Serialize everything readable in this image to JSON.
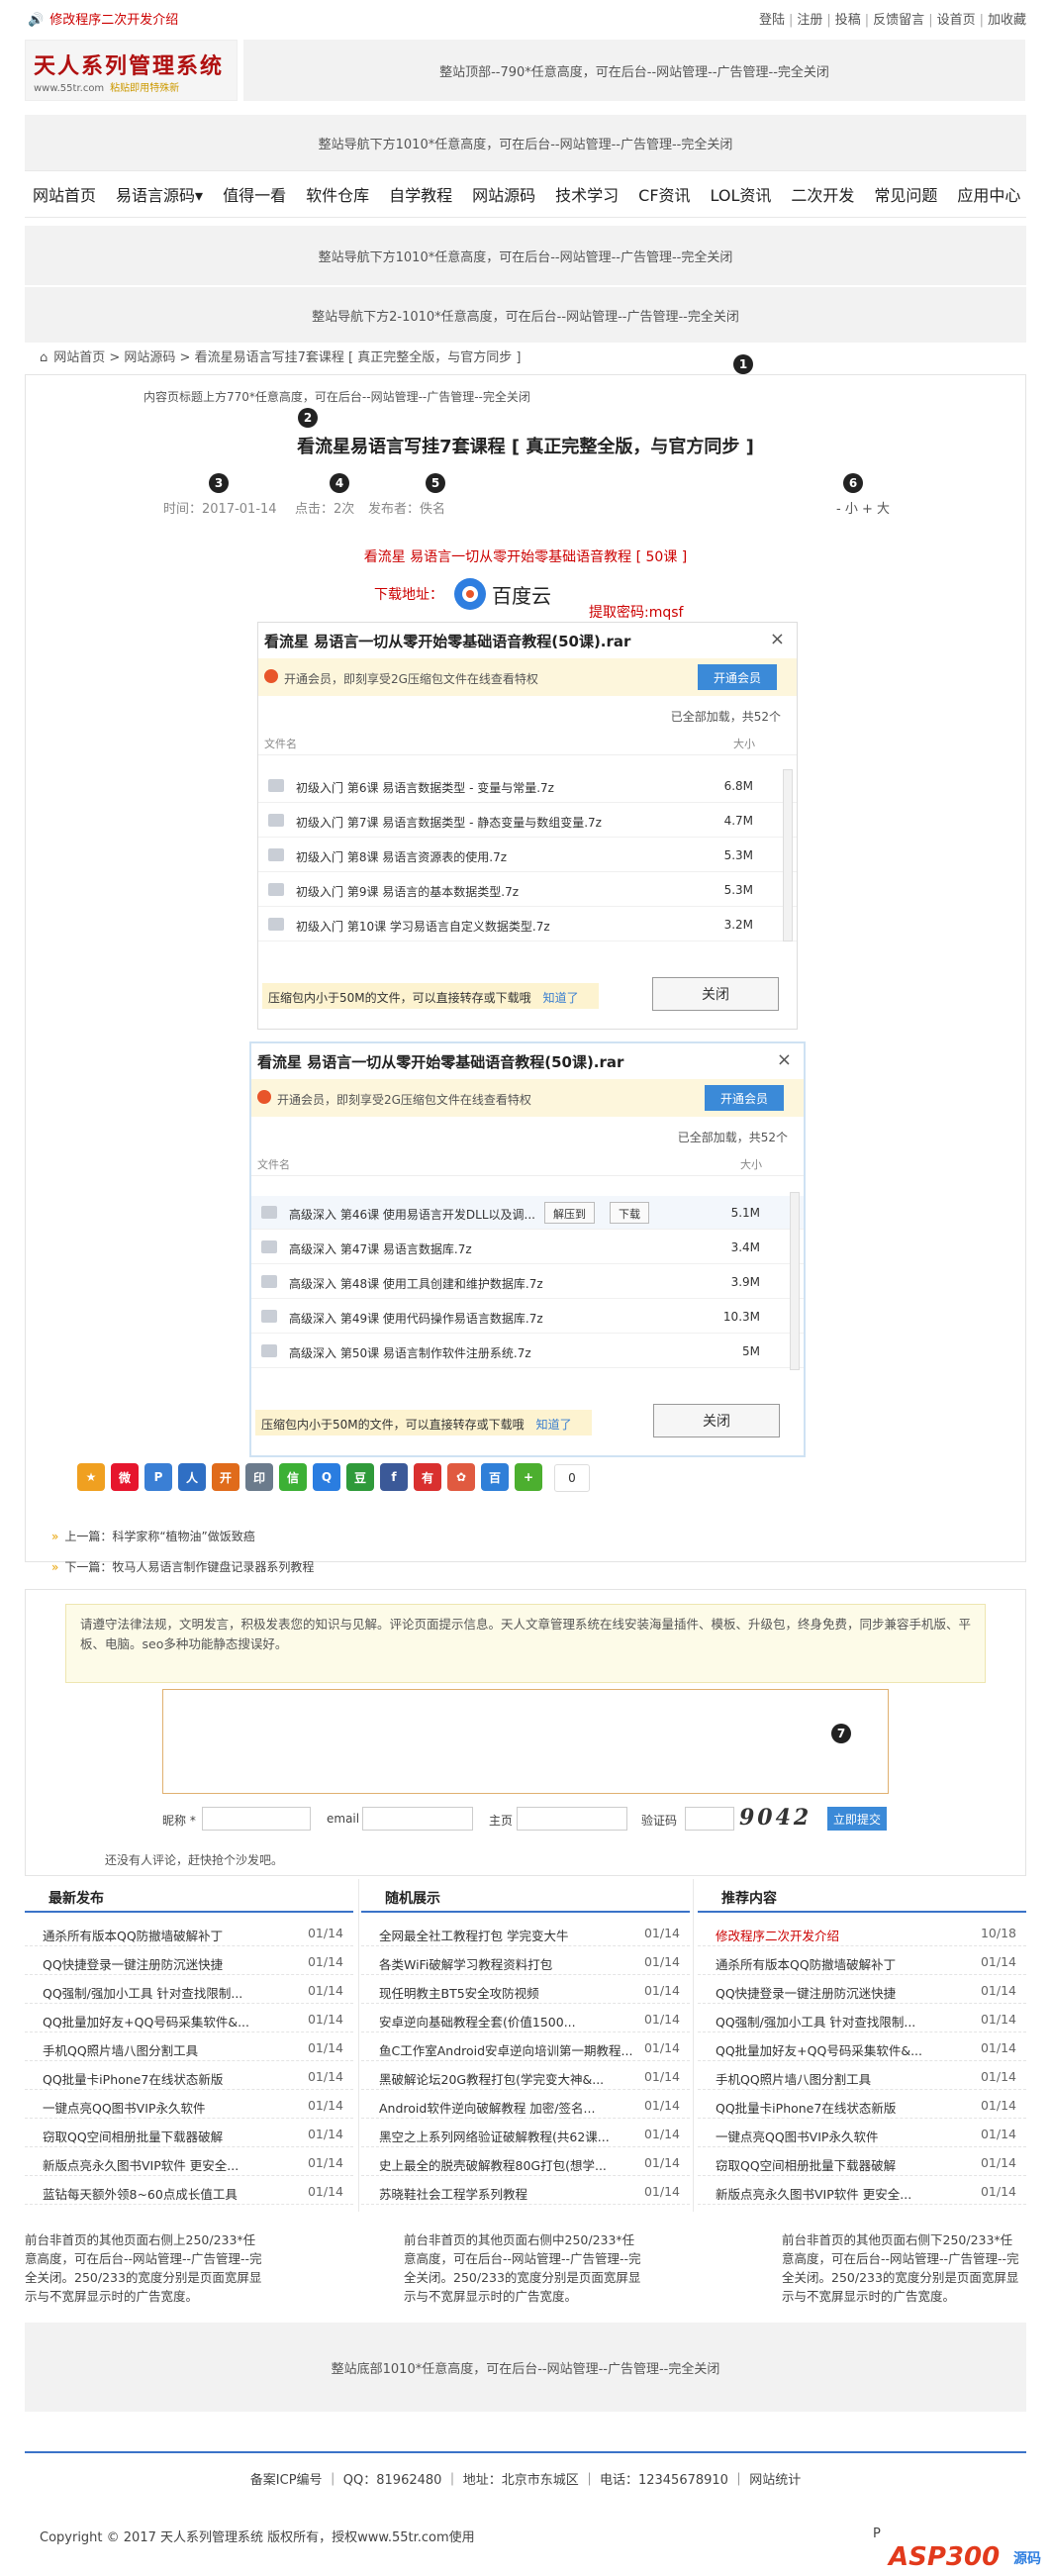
{
  "topbar": {
    "notice": "修改程序二次开发介绍",
    "links": [
      "登陆",
      "注册",
      "投稿",
      "反馈留言",
      "设首页",
      "加收藏"
    ]
  },
  "logo": {
    "title": "天人系列管理系统",
    "url": "www.55tr.com",
    "slogan": "粘贴即用特殊新"
  },
  "ads": {
    "header": "整站顶部--790*任意高度，可在后台--网站管理--广告管理--完全关闭",
    "nav_top": "整站导航下方1010*任意高度，可在后台--网站管理--广告管理--完全关闭",
    "nav_below1": "整站导航下方1010*任意高度，可在后台--网站管理--广告管理--完全关闭",
    "nav_below2": "整站导航下方2-1010*任意高度，可在后台--网站管理--广告管理--完全关闭",
    "content_top": "内容页标题上方770*任意高度，可在后台--网站管理--广告管理--完全关闭",
    "footer": "整站底部1010*任意高度，可在后台--网站管理--广告管理--完全关闭",
    "bottom": [
      "前台非首页的其他页面右侧上250/233*任意高度，可在后台--网站管理--广告管理--完全关闭。250/233的宽度分别是页面宽屏显示与不宽屏显示时的广告宽度。",
      "前台非首页的其他页面右侧中250/233*任意高度，可在后台--网站管理--广告管理--完全关闭。250/233的宽度分别是页面宽屏显示与不宽屏显示时的广告宽度。",
      "前台非首页的其他页面右侧下250/233*任意高度，可在后台--网站管理--广告管理--完全关闭。250/233的宽度分别是页面宽屏显示与不宽屏显示时的广告宽度。"
    ]
  },
  "nav": [
    "网站首页",
    "易语言源码▾",
    "值得一看",
    "软件仓库",
    "自学教程",
    "网站源码",
    "技术学习",
    "CF资讯",
    "LOL资讯",
    "二次开发",
    "常见问题",
    "应用中心"
  ],
  "breadcrumb": "网站首页 > 网站源码 > 看流星易语言写挂7套课程 [ 真正完整全版，与官方同步 ]",
  "article": {
    "title": "看流星易语言写挂7套课程 [ 真正完整全版，与官方同步 ]",
    "time": "时间：2017-01-14",
    "hits": "点击：2次",
    "author": "发布者：佚名",
    "fontsize": "- 小 + 大",
    "dl_title": "看流星 易语言一切从零开始零基础语音教程 [ 50课 ]",
    "dl_label": "下载地址：",
    "baidu": "百度云",
    "pwd": "提取密码:mqsf"
  },
  "badges": [
    "1",
    "2",
    "3",
    "4",
    "5",
    "6",
    "7"
  ],
  "pan1": {
    "title": "看流星 易语言一切从零开始零基础语音教程(50课).rar",
    "vip": "开通会员，即刻享受2G压缩包文件在线查看特权",
    "vip_btn": "开通会员",
    "count": "已全部加载，共52个",
    "col_name": "文件名",
    "col_size": "大小",
    "rows": [
      {
        "n": "初级入门 第6课 易语言数据类型 - 变量与常量.7z",
        "s": "6.8M"
      },
      {
        "n": "初级入门 第7课 易语言数据类型 - 静态变量与数组变量.7z",
        "s": "4.7M"
      },
      {
        "n": "初级入门 第8课 易语言资源表的使用.7z",
        "s": "5.3M"
      },
      {
        "n": "初级入门 第9课 易语言的基本数据类型.7z",
        "s": "5.3M"
      },
      {
        "n": "初级入门 第10课 学习易语言自定义数据类型.7z",
        "s": "3.2M"
      }
    ],
    "tip": "压缩包内小于50M的文件，可以直接转存或下载哦",
    "tip_link": "知道了",
    "close": "关闭"
  },
  "pan2": {
    "title": "看流星 易语言一切从零开始零基础语音教程(50课).rar",
    "vip": "开通会员，即刻享受2G压缩包文件在线查看特权",
    "vip_btn": "开通会员",
    "count": "已全部加载，共52个",
    "col_name": "文件名",
    "col_size": "大小",
    "rows": [
      {
        "n": "高级深入 第46课 使用易语言开发DLL以及调...",
        "s": "5.1M"
      },
      {
        "n": "高级深入 第47课 易语言数据库.7z",
        "s": "3.4M"
      },
      {
        "n": "高级深入 第48课 使用工具创建和维护数据库.7z",
        "s": "3.9M"
      },
      {
        "n": "高级深入 第49课 使用代码操作易语言数据库.7z",
        "s": "10.3M"
      },
      {
        "n": "高级深入 第50课 易语言制作软件注册系统.7z",
        "s": "5M"
      }
    ],
    "unzip": "解压到",
    "download": "下载",
    "tip": "压缩包内小于50M的文件，可以直接转存或下载哦",
    "tip_link": "知道了",
    "close": "关闭"
  },
  "share": {
    "icons": [
      {
        "name": "favorite-star-icon",
        "glyph": "★",
        "color": "#f0a020"
      },
      {
        "name": "weibo-icon",
        "glyph": "微",
        "color": "#e6162d"
      },
      {
        "name": "pinterest-icon",
        "glyph": "P",
        "color": "#3a7fd5"
      },
      {
        "name": "renren-icon",
        "glyph": "人",
        "color": "#2f6fc4"
      },
      {
        "name": "kaixin-icon",
        "glyph": "开",
        "color": "#e06b1b"
      },
      {
        "name": "print-icon",
        "glyph": "印",
        "color": "#6b7b8c"
      },
      {
        "name": "wechat-icon",
        "glyph": "信",
        "color": "#3cb035"
      },
      {
        "name": "qq-icon",
        "glyph": "Q",
        "color": "#2a7de0"
      },
      {
        "name": "douban-icon",
        "glyph": "豆",
        "color": "#2f9a3a"
      },
      {
        "name": "facebook-icon",
        "glyph": "f",
        "color": "#3b5998"
      },
      {
        "name": "youdao-icon",
        "glyph": "有",
        "color": "#d9302f"
      },
      {
        "name": "leaf-icon",
        "glyph": "✿",
        "color": "#e05a40"
      },
      {
        "name": "baidu-icon",
        "glyph": "百",
        "color": "#2f7fd8"
      },
      {
        "name": "more-plus-icon",
        "glyph": "+",
        "color": "#4caf2f"
      }
    ],
    "count": "0"
  },
  "prev": "上一篇：科学家称“植物油”做饭致癌",
  "next": "下一篇：牧马人易语言制作键盘记录器系列教程",
  "comment": {
    "notice": "请遵守法律法规，文明发言，积极发表您的知识与见解。评论页面提示信息。天人文章管理系统在线安装海量插件、模板、升级包，终身免费，同步兼容手机版、平板、电脑。seo多种功能静态搜误好。",
    "nick_label": "昵称 *",
    "email_label": "email",
    "home_label": "主页",
    "code_label": "验证码",
    "captcha": "9042",
    "submit": "立即提交",
    "none": "还没有人评论，赶快抢个沙发吧。"
  },
  "lists": [
    {
      "title": "最新发布",
      "items": [
        {
          "t": "通杀所有版本QQ防撤墙破解补丁",
          "d": "01/14"
        },
        {
          "t": "QQ快捷登录一键注册防沉迷快捷",
          "d": "01/14"
        },
        {
          "t": "QQ强制/强加小工具 针对查找限制...",
          "d": "01/14"
        },
        {
          "t": "QQ批量加好友+QQ号码采集软件&...",
          "d": "01/14"
        },
        {
          "t": "手机QQ照片墙八图分割工具",
          "d": "01/14"
        },
        {
          "t": "QQ批量卡iPhone7在线状态新版",
          "d": "01/14"
        },
        {
          "t": "一键点亮QQ图书VIP永久软件",
          "d": "01/14"
        },
        {
          "t": "窃取QQ空间相册批量下载器破解",
          "d": "01/14"
        },
        {
          "t": "新版点亮永久图书VIP软件 更安全...",
          "d": "01/14"
        },
        {
          "t": "蓝钻每天额外领8~60点成长值工具",
          "d": "01/14"
        }
      ]
    },
    {
      "title": "随机展示",
      "items": [
        {
          "t": "全网最全社工教程打包 学完变大牛",
          "d": "01/14"
        },
        {
          "t": "各类WiFi破解学习教程资料打包",
          "d": "01/14"
        },
        {
          "t": "现任明教主BT5安全攻防视频",
          "d": "01/14"
        },
        {
          "t": "安卓逆向基础教程全套(价值1500...",
          "d": "01/14"
        },
        {
          "t": "鱼C工作室Android安卓逆向培训第一期教程...",
          "d": "01/14"
        },
        {
          "t": "黑破解论坛20G教程打包(学完变大神&...",
          "d": "01/14"
        },
        {
          "t": "Android软件逆向破解教程 加密/签名...",
          "d": "01/14"
        },
        {
          "t": "黑空之上系列网络验证破解教程(共62课...",
          "d": "01/14"
        },
        {
          "t": "史上最全的脱壳破解教程80G打包(想学...",
          "d": "01/14"
        },
        {
          "t": "苏晓鞋社会工程学系列教程",
          "d": "01/14"
        }
      ]
    },
    {
      "title": "推荐内容",
      "items": [
        {
          "t": "修改程序二次开发介绍",
          "d": "10/18",
          "red": true
        },
        {
          "t": "通杀所有版本QQ防撤墙破解补丁",
          "d": "01/14"
        },
        {
          "t": "QQ快捷登录一键注册防沉迷快捷",
          "d": "01/14"
        },
        {
          "t": "QQ强制/强加小工具 针对查找限制...",
          "d": "01/14"
        },
        {
          "t": "QQ批量加好友+QQ号码采集软件&...",
          "d": "01/14"
        },
        {
          "t": "手机QQ照片墙八图分割工具",
          "d": "01/14"
        },
        {
          "t": "QQ批量卡iPhone7在线状态新版",
          "d": "01/14"
        },
        {
          "t": "一键点亮QQ图书VIP永久软件",
          "d": "01/14"
        },
        {
          "t": "窃取QQ空间相册批量下载器破解",
          "d": "01/14"
        },
        {
          "t": "新版点亮永久图书VIP软件 更安全...",
          "d": "01/14"
        }
      ]
    }
  ],
  "footer": {
    "icp": "备案ICP编号 ｜ QQ：81962480 ｜ 地址：北京市东城区 ｜ 电话：12345678910 ｜ 网站统计",
    "copyright": "Copyright © 2017 天人系列管理系统 版权所有，授权www.55tr.com使用",
    "p": "P",
    "asp": "ASP300",
    "asp_sub": "源码"
  }
}
